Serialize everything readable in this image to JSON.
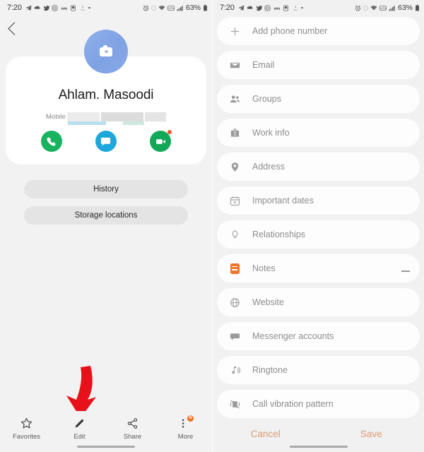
{
  "statusbar": {
    "time": "7:20",
    "left_icons": [
      "telegram-icon",
      "cloud-icon",
      "twitter-icon",
      "instagram-icon",
      "m-icon",
      "app-icon",
      "data-saver-icon",
      "dot-icon"
    ],
    "right_icons": [
      "alarm-icon",
      "circle-icon",
      "wifi-icon",
      "vpn-icon",
      "signal-icon"
    ],
    "battery": "63%"
  },
  "left": {
    "back_icon": "back-chevron-icon",
    "avatar_icon": "camera-icon",
    "contact_name": "Ahlam. Masoodi",
    "mobile_label": "Mobile",
    "mobile_number": "",
    "actions": [
      {
        "name": "call",
        "icon": "phone-icon",
        "color": "#17b35e"
      },
      {
        "name": "message",
        "icon": "message-icon",
        "color": "#1ea7db"
      },
      {
        "name": "video-call",
        "icon": "video-camera-icon",
        "color": "#12a858"
      }
    ],
    "buttons": [
      {
        "label": "History"
      },
      {
        "label": "Storage locations"
      }
    ],
    "bottom_nav": [
      {
        "label": "Favorites",
        "icon": "star-icon",
        "badge": ""
      },
      {
        "label": "Edit",
        "icon": "pencil-icon",
        "badge": ""
      },
      {
        "label": "Share",
        "icon": "share-icon",
        "badge": ""
      },
      {
        "label": "More",
        "icon": "more-dots-icon",
        "badge": "N"
      }
    ]
  },
  "right": {
    "items": [
      {
        "label": "Add phone number",
        "icon": "plus-icon",
        "trailing": ""
      },
      {
        "label": "Email",
        "icon": "envelope-icon",
        "trailing": ""
      },
      {
        "label": "Groups",
        "icon": "people-icon",
        "trailing": ""
      },
      {
        "label": "Work info",
        "icon": "briefcase-icon",
        "trailing": ""
      },
      {
        "label": "Address",
        "icon": "location-pin-icon",
        "trailing": ""
      },
      {
        "label": "Important dates",
        "icon": "calendar-icon",
        "trailing": ""
      },
      {
        "label": "Relationships",
        "icon": "relationship-icon",
        "trailing": ""
      },
      {
        "label": "Notes",
        "icon": "notes-icon",
        "trailing": "minus-icon"
      },
      {
        "label": "Website",
        "icon": "globe-icon",
        "trailing": ""
      },
      {
        "label": "Messenger accounts",
        "icon": "chat-bubble-icon",
        "trailing": ""
      },
      {
        "label": "Ringtone",
        "icon": "music-note-icon",
        "trailing": ""
      },
      {
        "label": "Call vibration pattern",
        "icon": "vibration-off-icon",
        "trailing": ""
      }
    ],
    "footer": {
      "cancel_label": "Cancel",
      "save_label": "Save",
      "accent_color": "#d99a72"
    }
  },
  "annotations": [
    {
      "name": "arrow-pointing-to-edit",
      "color": "#e8111a"
    },
    {
      "name": "arrow-pointing-to-ringtone",
      "color": "#e8111a"
    }
  ]
}
